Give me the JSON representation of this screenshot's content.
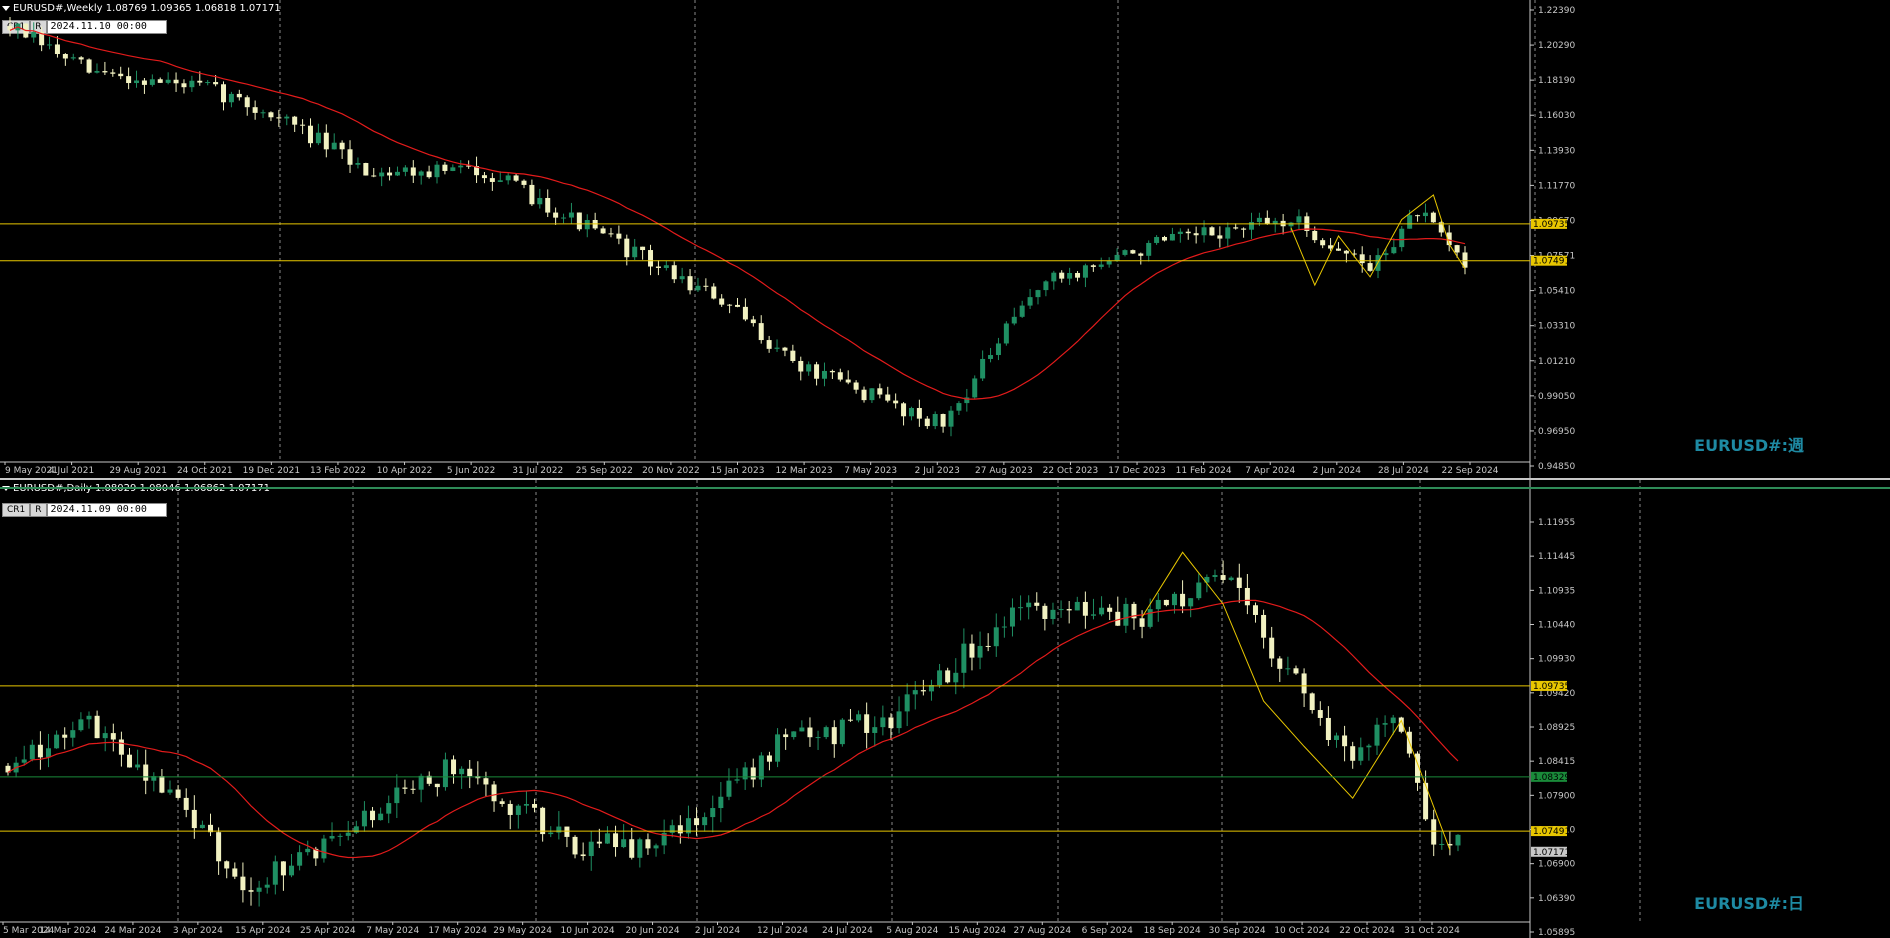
{
  "colors": {
    "background": "#000000",
    "bull": "#1f8f63",
    "bear": "#f2f2c2",
    "ma": "#e31b1b",
    "level": "#e8c700",
    "zigzag": "#e8c700",
    "grid": "#888888",
    "axis": "#c8c8c8",
    "green_line": "#1a8a3a",
    "watermark": "#1e8aa3"
  },
  "buttons": {
    "cr1": "CR1",
    "r": "R"
  },
  "weekly": {
    "title": "EURUSD#,Weekly  1.08769 1.09365 1.06818 1.07171",
    "datetime": "2024.11.10 00:00",
    "watermark": "EURUSD#:週",
    "ylim": [
      0.9485,
      1.229
    ],
    "yticks": [
      "1.22390",
      "1.20290",
      "1.18190",
      "1.16030",
      "1.13930",
      "1.11770",
      "1.09670",
      "1.07571",
      "1.05410",
      "1.03310",
      "1.01210",
      "0.99050",
      "0.96950",
      "0.94850"
    ],
    "level_labels": [
      "1.09735",
      "1.07491"
    ],
    "levels": [
      1.09735,
      1.07491
    ],
    "xlabels": [
      "9 May 2021",
      "4 Jul 2021",
      "29 Aug 2021",
      "24 Oct 2021",
      "19 Dec 2021",
      "13 Feb 2022",
      "10 Apr 2022",
      "5 Jun 2022",
      "31 Jul 2022",
      "25 Sep 2022",
      "20 Nov 2022",
      "15 Jan 2023",
      "12 Mar 2023",
      "7 May 2023",
      "2 Jul 2023",
      "27 Aug 2023",
      "22 Oct 2023",
      "17 Dec 2023",
      "11 Feb 2024",
      "7 Apr 2024",
      "2 Jun 2024",
      "28 Jul 2024",
      "22 Sep 2024"
    ]
  },
  "daily": {
    "title": "EURUSD#,Daily  1.08029 1.08046 1.06862 1.07171",
    "datetime": "2024.11.09 00:00",
    "watermark": "EURUSD#:日",
    "ylim": [
      1.059,
      1.123
    ],
    "yticks": [
      "1.11955",
      "1.11445",
      "1.10935",
      "1.10440",
      "1.09930",
      "1.09420",
      "1.08925",
      "1.08415",
      "1.07900",
      "1.07410",
      "1.06900",
      "1.06390",
      "1.05895"
    ],
    "level_labels": [
      "1.09735",
      "1.07491",
      "1.08329",
      "1.07171"
    ],
    "levels": [
      1.09735,
      1.07491
    ],
    "green_level": 1.08329,
    "last_price": 1.07171,
    "xlabels": [
      "5 Mar 2024",
      "14 Mar 2024",
      "24 Mar 2024",
      "3 Apr 2024",
      "15 Apr 2024",
      "25 Apr 2024",
      "7 May 2024",
      "17 May 2024",
      "29 May 2024",
      "10 Jun 2024",
      "20 Jun 2024",
      "2 Jul 2024",
      "12 Jul 2024",
      "24 Jul 2024",
      "5 Aug 2024",
      "15 Aug 2024",
      "27 Aug 2024",
      "6 Sep 2024",
      "18 Sep 2024",
      "30 Sep 2024",
      "10 Oct 2024",
      "22 Oct 2024",
      "31 Oct 2024"
    ]
  }
}
